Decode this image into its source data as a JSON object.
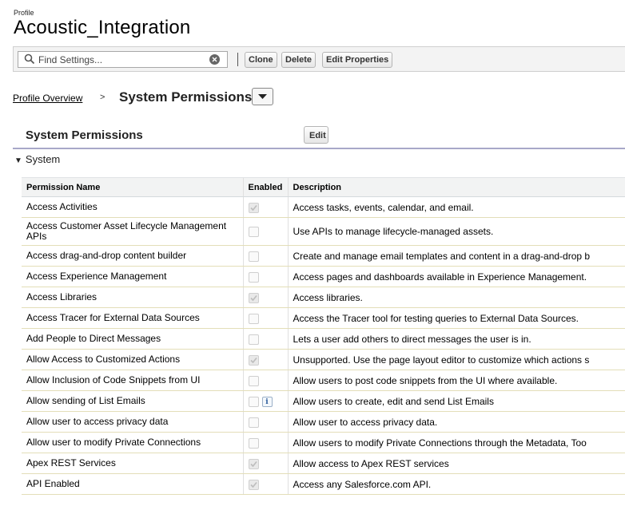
{
  "header": {
    "profile_label": "Profile",
    "title": "Acoustic_Integration"
  },
  "toolbar": {
    "search_placeholder": "Find Settings...",
    "clone_label": "Clone",
    "delete_label": "Delete",
    "edit_properties_label": "Edit Properties"
  },
  "breadcrumb": {
    "overview_link": "Profile Overview",
    "separator": ">",
    "current": "System Permissions"
  },
  "section": {
    "title": "System Permissions",
    "edit_label": "Edit",
    "group_label": "System",
    "group_marker": "▼"
  },
  "table": {
    "columns": [
      "Permission Name",
      "Enabled",
      "Description"
    ],
    "rows": [
      {
        "name": "Access Activities",
        "enabled": true,
        "description": "Access tasks, events, calendar, and email."
      },
      {
        "name": "Access Customer Asset Lifecycle Management APIs",
        "enabled": false,
        "description": "Use APIs to manage lifecycle-managed assets."
      },
      {
        "name": "Access drag-and-drop content builder",
        "enabled": false,
        "description": "Create and manage email templates and content in a drag-and-drop b"
      },
      {
        "name": "Access Experience Management",
        "enabled": false,
        "description": "Access pages and dashboards available in Experience Management."
      },
      {
        "name": "Access Libraries",
        "enabled": true,
        "description": "Access libraries."
      },
      {
        "name": "Access Tracer for External Data Sources",
        "enabled": false,
        "description": "Access the Tracer tool for testing queries to External Data Sources."
      },
      {
        "name": "Add People to Direct Messages",
        "enabled": false,
        "description": "Lets a user add others to direct messages the user is in."
      },
      {
        "name": "Allow Access to Customized Actions",
        "enabled": true,
        "description": "Unsupported. Use the page layout editor to customize which actions s"
      },
      {
        "name": "Allow Inclusion of Code Snippets from UI",
        "enabled": false,
        "description": "Allow users to post code snippets from the UI where available."
      },
      {
        "name": "Allow sending of List Emails",
        "enabled": false,
        "info": "i",
        "description": "Allow users to create, edit and send List Emails"
      },
      {
        "name": "Allow user to access privacy data",
        "enabled": false,
        "description": "Allow user to access privacy data."
      },
      {
        "name": "Allow user to modify Private Connections",
        "enabled": false,
        "description": "Allow users to modify Private Connections through the Metadata, Too"
      },
      {
        "name": "Apex REST Services",
        "enabled": true,
        "description": "Allow access to Apex REST services"
      },
      {
        "name": "API Enabled",
        "enabled": true,
        "description": "Access any Salesforce.com API."
      }
    ]
  }
}
